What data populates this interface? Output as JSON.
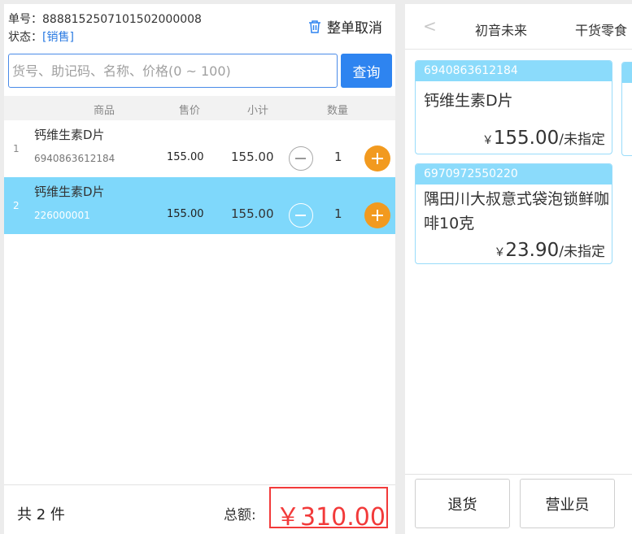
{
  "order": {
    "number_label": "单号：",
    "number": "8888152507101502000008",
    "status_label": "状态：",
    "status": "[销售]",
    "cancel_all": "整单取消"
  },
  "search": {
    "placeholder": "货号、助记码、名称、价格(0 ~ 100)",
    "value": "",
    "button": "查询"
  },
  "table": {
    "headers": {
      "product": "商品",
      "price": "售价",
      "subtotal": "小计",
      "quantity": "数量"
    },
    "rows": [
      {
        "index": "1",
        "name": "钙维生素D片",
        "code": "6940863612184",
        "price": "155.00",
        "subtotal": "155.00",
        "qty": "1",
        "selected": false
      },
      {
        "index": "2",
        "name": "钙维生素D片",
        "code": "226000001",
        "price": "155.00",
        "subtotal": "155.00",
        "qty": "1",
        "selected": true
      }
    ]
  },
  "footer": {
    "count": "共 2 件",
    "total_label": "总额:",
    "total": "￥310.00"
  },
  "categories": {
    "items": [
      "初音未来",
      "干货零食"
    ]
  },
  "products": [
    {
      "barcode": "6940863612184",
      "name": "钙维生素D片",
      "currency": "￥",
      "price": "155.00",
      "unit": "/未指定"
    },
    {
      "barcode": "6970972550220",
      "name": "隅田川大叔意式袋泡锁鲜咖啡10克",
      "currency": "￥",
      "price": "23.90",
      "unit": "/未指定"
    }
  ],
  "actions": {
    "return": "退货",
    "salesperson": "营业员"
  },
  "colors": {
    "accent": "#2e84f0",
    "selected_row": "#7fd8fb",
    "plus_button": "#f29a1f",
    "total": "#f23a3a",
    "card_header": "#8bdbfb"
  }
}
